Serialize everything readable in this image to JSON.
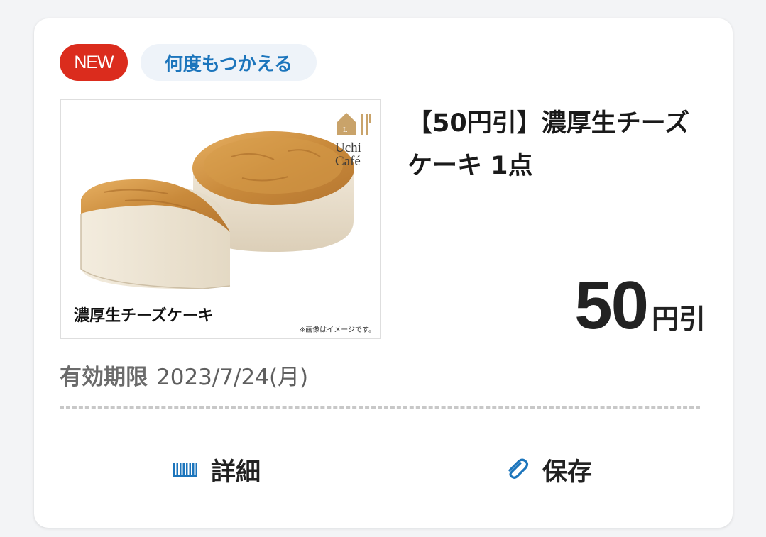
{
  "badges": {
    "new": "NEW",
    "reusable": "何度もつかえる"
  },
  "product": {
    "title": "【50円引】濃厚生チーズケーキ 1点",
    "image_caption": "濃厚生チーズケーキ",
    "image_note": "※画像はイメージです。",
    "brand_line1": "Uchi",
    "brand_line2": "Café"
  },
  "discount": {
    "amount": "50",
    "unit": "円引"
  },
  "expiry": {
    "label": "有効期限",
    "date": "2023/7/24(月)"
  },
  "actions": {
    "details_label": "詳細",
    "save_label": "保存"
  },
  "colors": {
    "new_badge": "#db2c1d",
    "accent_blue": "#1c75bc",
    "reuse_badge_bg": "#eef3f9",
    "card_bg": "#ffffff",
    "page_bg": "#f3f4f6"
  },
  "icons": {
    "details": "barcode-icon",
    "save": "paperclip-icon"
  }
}
